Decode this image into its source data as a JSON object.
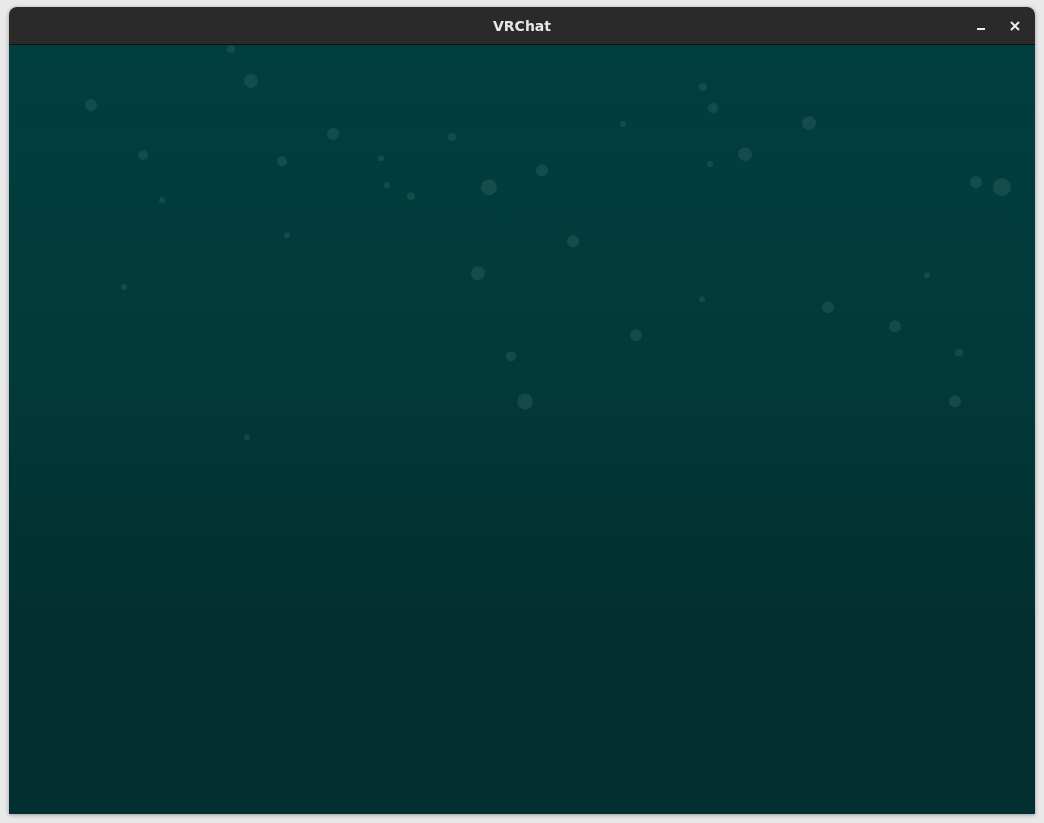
{
  "window": {
    "title": "VRChat"
  }
}
